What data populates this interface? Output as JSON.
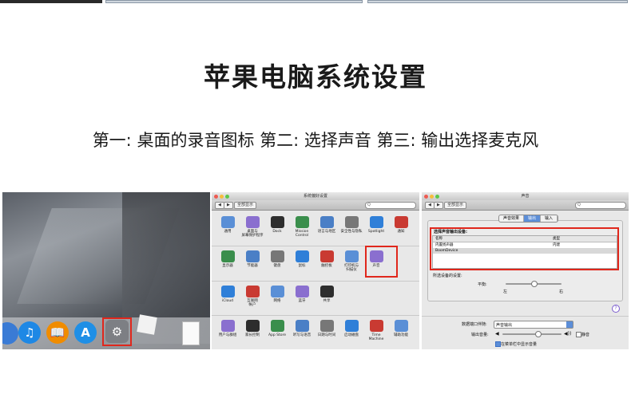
{
  "page": {
    "title": "苹果电脑系统设置",
    "subtitle": "第一: 桌面的录音图标  第二: 选择声音 第三: 输出选择麦克风"
  },
  "panel1": {
    "dock_icons": [
      "music-icon",
      "books-icon",
      "app-store-icon",
      "system-preferences-icon"
    ],
    "dock_labels": [
      "♫",
      "📖",
      "A",
      "⚙"
    ]
  },
  "panel2": {
    "window_title": "系统偏好设置",
    "show_all": "全部显示",
    "nav_back": "◀",
    "nav_fwd": "▶",
    "search_placeholder": "Q",
    "row1": [
      "通用",
      "桌面与\n屏幕保护程序",
      "Dock",
      "Mission\nControl",
      "语言与地区",
      "安全性与隐私",
      "Spotlight",
      "通知"
    ],
    "row2": [
      "显示器",
      "节能器",
      "键盘",
      "鼠标",
      "触控板",
      "打印机与\n扫描仪",
      "声音"
    ],
    "row3": [
      "iCloud",
      "互联网\n帐户",
      "网络",
      "蓝牙",
      "共享"
    ],
    "row4": [
      "用户与群组",
      "家长控制",
      "App Store",
      "听写与语音",
      "日期与时间",
      "启动磁盘",
      "Time Machine",
      "辅助功能"
    ]
  },
  "panel3": {
    "window_title": "声音",
    "show_all": "全部显示",
    "tabs": [
      "声音效果",
      "输出",
      "输入"
    ],
    "active_tab": 1,
    "section_label": "选择声音输出设备:",
    "col_name": "名称",
    "col_type": "类型",
    "devices": [
      {
        "name": "内置扬声器",
        "type": "内建"
      },
      {
        "name": "BoomDevice",
        "type": ""
      }
    ],
    "settings_label": "所选设备的设置:",
    "balance_label": "平衡:",
    "left_label": "左",
    "right_label": "右",
    "alert_label": "数据端口伴随:",
    "alert_value": "声音输出",
    "volume_label": "输出音量:",
    "mute_label": "静音",
    "menubar_label": "在菜单栏中显示音量",
    "help": "?",
    "balance": 0.5,
    "volume": 0.6
  },
  "colors": {
    "highlight": "#e0271c",
    "tab_active": "#5c8ed8"
  }
}
